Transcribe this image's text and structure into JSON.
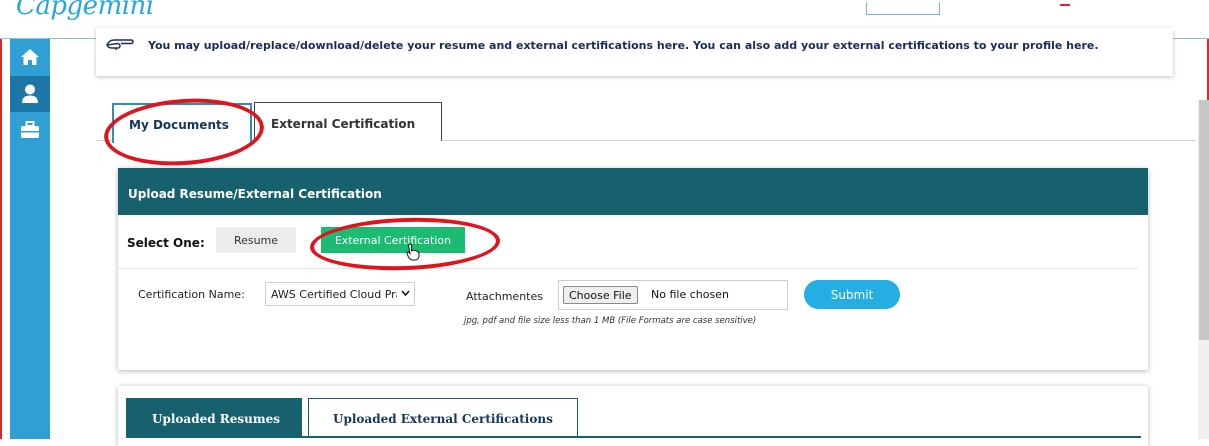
{
  "app": {
    "logo_text": "Capgemini"
  },
  "sidebar": {
    "items": [
      {
        "icon": "home-icon"
      },
      {
        "icon": "user-icon",
        "active": true
      },
      {
        "icon": "briefcase-icon"
      }
    ]
  },
  "info": {
    "text": "You may upload/replace/download/delete your resume and external certifications here.  You can also add your external certifications to your profile here."
  },
  "tabs": [
    {
      "label": "My Documents",
      "active": true
    },
    {
      "label": "External Certification"
    }
  ],
  "upload": {
    "title": "Upload Resume/External Certification",
    "select_label": "Select One:",
    "options": [
      {
        "label": "Resume"
      },
      {
        "label": "External Certification",
        "selected": true
      }
    ],
    "cert_name_label": "Certification Name:",
    "cert_name_value": "AWS Certified Cloud Pra",
    "attachments_label": "Attachmentes",
    "choose_file_label": "Choose File",
    "no_file_text": "No file chosen",
    "submit_label": "Submit",
    "hint": "jpg, pdf and file size less than 1 MB (File Formats are case sensitive)"
  },
  "uploaded": {
    "tabs": [
      {
        "label": "Uploaded Resumes",
        "active": true
      },
      {
        "label": "Uploaded External Certifications"
      }
    ]
  },
  "colors": {
    "accent_teal": "#17616e",
    "sidebar_blue": "#2f9fd4",
    "success_green": "#1cbb72",
    "submit_blue": "#25aee3",
    "annotation_red": "#e0141e"
  }
}
